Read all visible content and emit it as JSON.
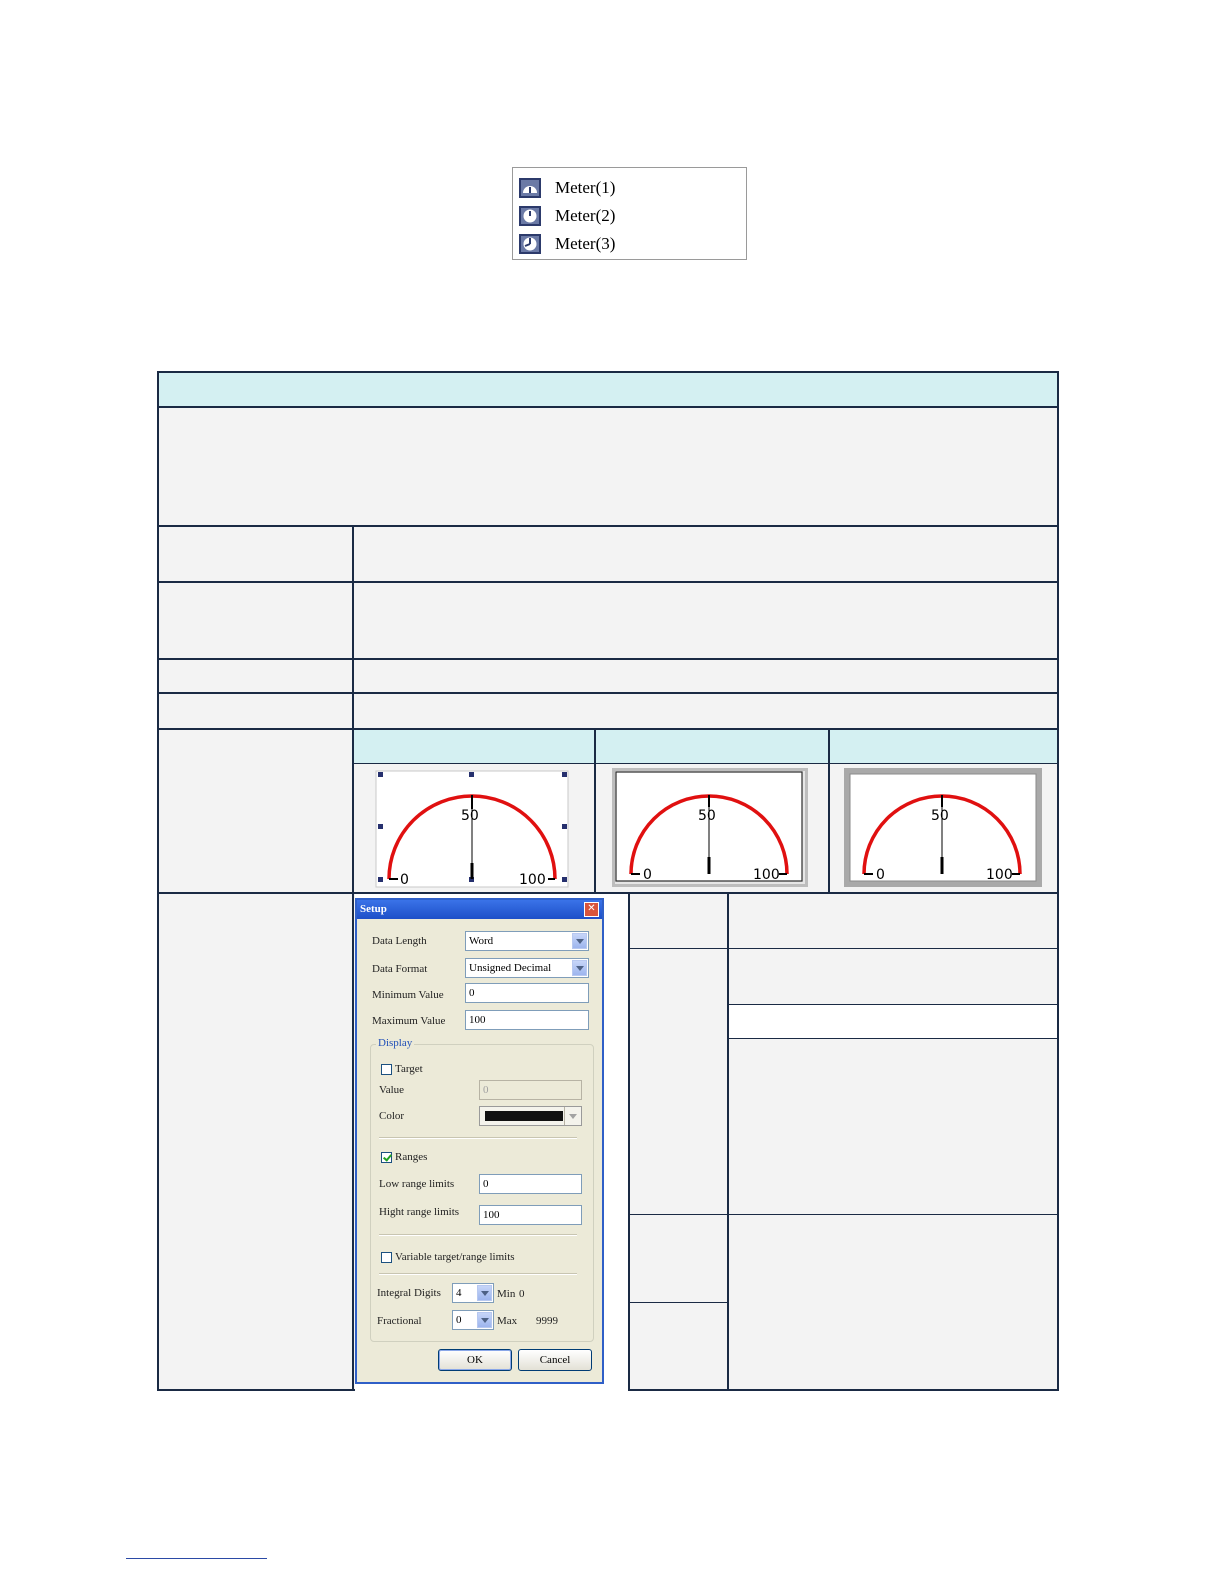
{
  "menu": {
    "items": [
      {
        "label": "Meter(1)",
        "icon": "half-meter-icon"
      },
      {
        "label": "Meter(2)",
        "icon": "clock-meter-icon"
      },
      {
        "label": "Meter(3)",
        "icon": "full-meter-icon"
      }
    ]
  },
  "meters": [
    {
      "scale_min": "0",
      "scale_mid": "50",
      "scale_max": "100",
      "style": "selected-no-frame"
    },
    {
      "scale_min": "0",
      "scale_mid": "50",
      "scale_max": "100",
      "style": "framed"
    },
    {
      "scale_min": "0",
      "scale_mid": "50",
      "scale_max": "100",
      "style": "gray-framed"
    }
  ],
  "setup": {
    "title": "Setup",
    "close_glyph": "✕",
    "data_length_label": "Data Length",
    "data_length_value": "Word",
    "data_format_label": "Data Format",
    "data_format_value": "Unsigned Decimal",
    "min_label": "Minimum Value",
    "min_value": "0",
    "max_label": "Maximum Value",
    "max_value": "100",
    "display_group": "Display",
    "target_label": "Target",
    "target_checked": false,
    "value_label": "Value",
    "value_value": "0",
    "color_label": "Color",
    "target_color": "#111111",
    "ranges_label": "Ranges",
    "ranges_checked": true,
    "low_label": "Low range limits",
    "low_value": "0",
    "high_label": "Hight range limits",
    "high_value": "100",
    "variable_label": "Variable target/range limits",
    "variable_checked": false,
    "integral_label": "Integral Digits",
    "integral_value": "4",
    "fractional_label": "Fractional",
    "fractional_value": "0",
    "min_hint_label": "Min",
    "min_hint_value": "0",
    "max_hint_label": "Max",
    "max_hint_value": "9999",
    "ok_label": "OK",
    "cancel_label": "Cancel"
  },
  "colors": {
    "table_border": "#1a2a44",
    "header_fill": "#d4f0f2",
    "cell_fill": "#f3f3f3",
    "meter_arc": "#e01010"
  }
}
